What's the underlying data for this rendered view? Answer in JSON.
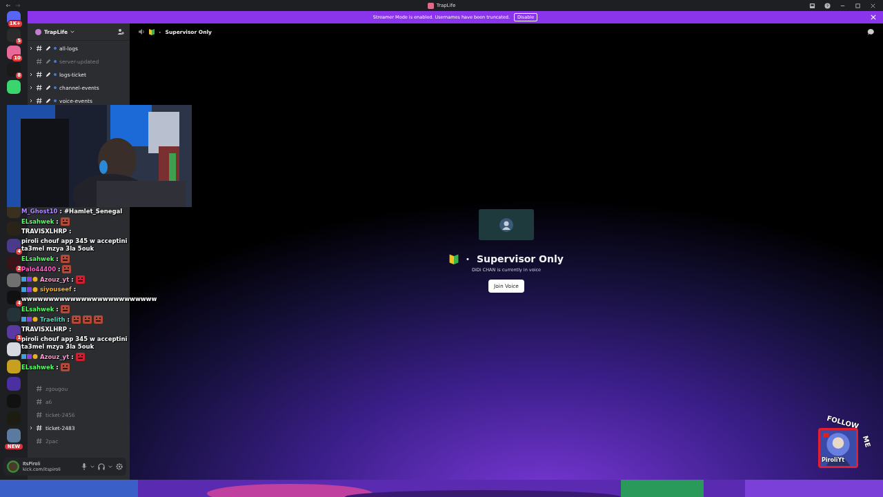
{
  "window": {
    "title": "TrapLife"
  },
  "banner": {
    "text": "Streamer Mode is enabled. Usernames have been truncated.",
    "button": "Disable"
  },
  "servers_top": [
    {
      "color": "#5865f2",
      "badge": "1K+"
    },
    {
      "color": "#2b2b2b",
      "badge": "5"
    },
    {
      "color": "#e86a9a",
      "badge": "10"
    },
    {
      "color": "#1a1a1a",
      "badge": "8"
    },
    {
      "color": "#3ad56c"
    }
  ],
  "servers_bottom": [
    {
      "color": "#3a3020"
    },
    {
      "color": "#2a2418"
    },
    {
      "color": "#4a3a8a",
      "badge": "4"
    },
    {
      "color": "#3a1418",
      "badge": "2"
    },
    {
      "color": "#707070"
    },
    {
      "color": "#101010",
      "badge": "4"
    },
    {
      "color": "#24323a"
    },
    {
      "color": "#5a3aa0",
      "badge": "1"
    },
    {
      "color": "#d8d8e0"
    },
    {
      "color": "#c8a020"
    },
    {
      "color": "#4a30a0"
    },
    {
      "color": "#111111"
    },
    {
      "color": "#1c1c10"
    },
    {
      "color": "#5a7aa0"
    }
  ],
  "new_badge": "NEW",
  "server_header": {
    "name": "TrapLife"
  },
  "channels_top": [
    {
      "name": "all-logs",
      "unread": true,
      "kind": "linked"
    },
    {
      "name": "server-updated",
      "unread": false,
      "kind": "linked"
    },
    {
      "name": "logs-ticket",
      "unread": true,
      "kind": "linked"
    },
    {
      "name": "channel-events",
      "unread": true,
      "kind": "linked"
    },
    {
      "name": "voice-events",
      "unread": true,
      "kind": "linked"
    }
  ],
  "channels_bottom": [
    {
      "name": "zgougou",
      "unread": false,
      "kind": "plain"
    },
    {
      "name": "a6",
      "unread": false,
      "kind": "plain"
    },
    {
      "name": "ticket-2456",
      "unread": false,
      "kind": "plain"
    },
    {
      "name": "ticket-2483",
      "unread": true,
      "kind": "plain"
    },
    {
      "name": "2pac",
      "unread": false,
      "kind": "plain"
    }
  ],
  "user_panel": {
    "name": "ItsPiroli",
    "status": "kick.com/itspiroli"
  },
  "header": {
    "separator": "•",
    "channel": "Supervisor Only"
  },
  "voice_card": {
    "separator": "•",
    "title": "Supervisor Only",
    "subtitle": "DiDi CHAN is currently in voice",
    "button": "Join Voice"
  },
  "chat": [
    {
      "user": "M_Ghost10",
      "color": "#b08aff",
      "sep": ":",
      "text": "#Hamlet_Senegal"
    },
    {
      "user": "ELsahwek",
      "color": "#5cff6a",
      "sep": ":",
      "emotes": [
        {
          "kind": "face"
        }
      ]
    },
    {
      "user": "TRAVISXLHRP",
      "color": "#ffffff",
      "sep": ":",
      "text": "piroli chouf app 345 w acceptini ta3mel mzya 3la 5ouk"
    },
    {
      "user": "ELsahwek",
      "color": "#5cff6a",
      "sep": ":",
      "emotes": [
        {
          "kind": "face"
        }
      ]
    },
    {
      "user": "Palo44400",
      "color": "#ff5cc8",
      "sep": ":",
      "emotes": [
        {
          "kind": "face"
        }
      ]
    },
    {
      "user": "Azouz_yt",
      "color": "#ff9ad0",
      "sep": ":",
      "emotes": [
        {
          "kind": "devil"
        }
      ],
      "badges": true
    },
    {
      "user": "siyouseef",
      "color": "#ffb020",
      "sep": ":",
      "text": "wwwwwwwwwwwwwwwwwwwwwwwww",
      "badges": true
    },
    {
      "user": "ELsahwek",
      "color": "#5cff6a",
      "sep": ":",
      "emotes": [
        {
          "kind": "face"
        }
      ]
    },
    {
      "user": "Traelith",
      "color": "#40e0c0",
      "sep": ":",
      "emotes": [
        {
          "kind": "face"
        },
        {
          "kind": "face"
        },
        {
          "kind": "face"
        }
      ],
      "badges": true
    },
    {
      "user": "TRAVISXLHRP",
      "color": "#ffffff",
      "sep": ":",
      "text": "piroli chouf app 345 w acceptini ta3mel mzya 3la 5ouk"
    },
    {
      "user": "Azouz_yt",
      "color": "#ff9ad0",
      "sep": ":",
      "emotes": [
        {
          "kind": "devil"
        }
      ],
      "badges": true
    },
    {
      "user": "ELsahwek",
      "color": "#5cff6a",
      "sep": ":",
      "emotes": [
        {
          "kind": "face"
        }
      ]
    }
  ],
  "follow": {
    "title": "FOLLOW",
    "title2": "ME",
    "handle": "PiroliYt"
  }
}
